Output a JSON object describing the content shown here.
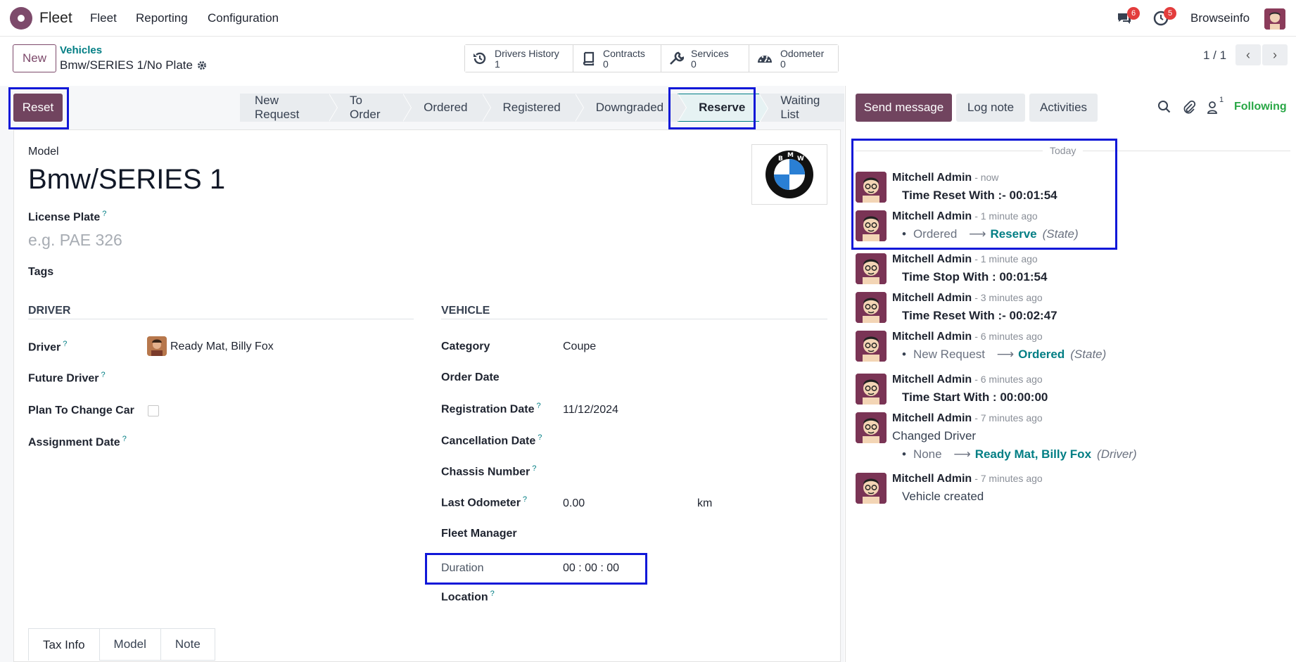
{
  "topbar": {
    "app_name": "Fleet",
    "menu": [
      "Fleet",
      "Reporting",
      "Configuration"
    ],
    "messages_badge": "6",
    "activities_badge": "5",
    "user_name": "Browseinfo"
  },
  "control": {
    "new_label": "New",
    "breadcrumb_parent": "Vehicles",
    "breadcrumb_current": "Bmw/SERIES 1/No Plate",
    "smart_buttons": [
      {
        "label": "Drivers History",
        "value": "1"
      },
      {
        "label": "Contracts",
        "value": "0"
      },
      {
        "label": "Services",
        "value": "0"
      },
      {
        "label": "Odometer",
        "value": "0"
      }
    ],
    "pager": "1 / 1"
  },
  "statusbar": {
    "reset_label": "Reset",
    "stages": [
      "New Request",
      "To Order",
      "Ordered",
      "Registered",
      "Downgraded",
      "Reserve",
      "Waiting List"
    ],
    "active_stage": "Reserve"
  },
  "form": {
    "model_label": "Model",
    "model_value": "Bmw/SERIES 1",
    "license_plate_label": "License Plate",
    "license_plate_placeholder": "e.g. PAE 326",
    "tags_label": "Tags",
    "driver_group_title": "DRIVER",
    "vehicle_group_title": "VEHICLE",
    "driver_label": "Driver",
    "driver_value": "Ready Mat, Billy Fox",
    "future_driver_label": "Future Driver",
    "plan_change_label": "Plan To Change Car",
    "assignment_date_label": "Assignment Date",
    "category_label": "Category",
    "category_value": "Coupe",
    "order_date_label": "Order Date",
    "registration_date_label": "Registration Date",
    "registration_date_value": "11/12/2024",
    "cancellation_date_label": "Cancellation Date",
    "chassis_label": "Chassis Number",
    "odometer_label": "Last Odometer",
    "odometer_value": "0.00",
    "odometer_unit": "km",
    "fleet_manager_label": "Fleet Manager",
    "duration_label": "Duration",
    "duration_value": "00 : 00 : 00",
    "location_label": "Location",
    "help_mark": "?",
    "tabs": [
      "Tax Info",
      "Model",
      "Note"
    ]
  },
  "chatter": {
    "send_message": "Send message",
    "log_note": "Log note",
    "activities": "Activities",
    "followers_count": "1",
    "following": "Following",
    "today": "Today",
    "messages": [
      {
        "author": "Mitchell Admin",
        "date": "- now",
        "body": "Time Reset With :- 00:01:54"
      },
      {
        "author": "Mitchell Admin",
        "date": "- 1 minute ago",
        "old": "Ordered",
        "new": "Reserve",
        "field": "(State)"
      },
      {
        "author": "Mitchell Admin",
        "date": "- 1 minute ago",
        "body": "Time Stop With : 00:01:54"
      },
      {
        "author": "Mitchell Admin",
        "date": "- 3 minutes ago",
        "body": "Time Reset With :- 00:02:47"
      },
      {
        "author": "Mitchell Admin",
        "date": "- 6 minutes ago",
        "old": "New Request",
        "new": "Ordered",
        "field": "(State)"
      },
      {
        "author": "Mitchell Admin",
        "date": "- 6 minutes ago",
        "body": "Time Start With : 00:00:00"
      },
      {
        "author": "Mitchell Admin",
        "date": "- 7 minutes ago",
        "plain": "Changed Driver",
        "old": "None",
        "new": "Ready Mat, Billy Fox",
        "field": "(Driver)"
      },
      {
        "author": "Mitchell Admin",
        "date": "- 7 minutes ago",
        "vc": "Vehicle created"
      }
    ]
  }
}
